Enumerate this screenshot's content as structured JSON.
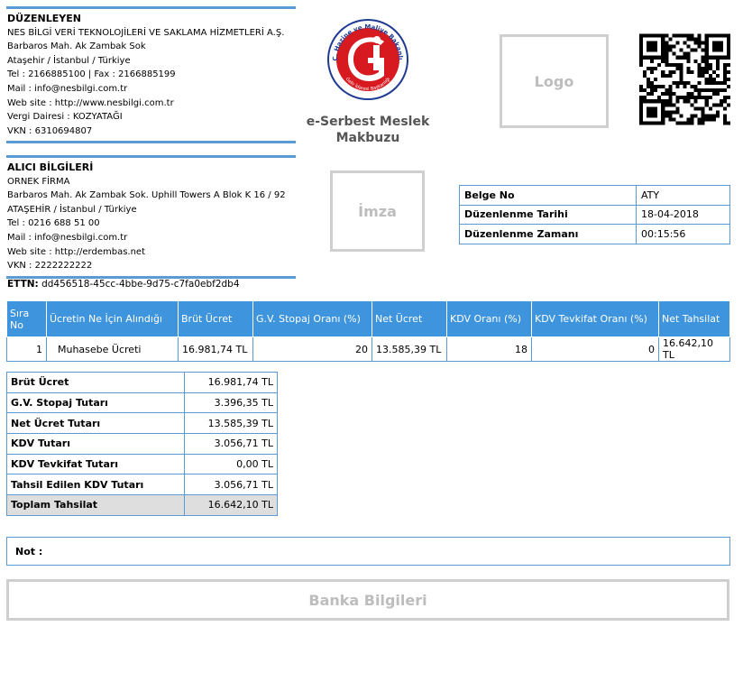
{
  "seller": {
    "title": "DÜZENLEYEN",
    "lines": [
      "NES BİLGİ VERİ TEKNOLOJİLERİ VE SAKLAMA HİZMETLERİ A.Ş.",
      "Barbaros Mah. Ak Zambak Sok",
      "Ataşehir / İstanbul / Türkiye",
      "Tel : 2166885100 | Fax : 2166885199",
      "Mail : info@nesbilgi.com.tr",
      "Web site : http://www.nesbilgi.com.tr",
      "Vergi Dairesi : KOZYATAĞI",
      "VKN : 6310694807"
    ]
  },
  "buyer": {
    "title": "ALICI BİLGİLERİ",
    "lines": [
      "ORNEK FİRMA",
      "Barbaros Mah. Ak Zambak Sok. Uphill Towers A Blok K 16 / 92",
      "ATAŞEHİR / İstanbul / Türkiye",
      "Tel : 0216 688 51 00",
      "Mail : info@nesbilgi.com.tr",
      "Web site : http://erdembas.net",
      "VKN : 2222222222"
    ]
  },
  "emblem": {
    "icon": "gib-emblem-icon",
    "ring_text": "T.C. Hazine ve Maliye Bakanlığı",
    "ring_text_bottom": "Gelir İdaresi Başkanlığı"
  },
  "document_title": [
    "e-Serbest Meslek",
    "Makbuzu"
  ],
  "logo_placeholder": "Logo",
  "signature_placeholder": "İmza",
  "qr": {
    "icon": "qr-code-icon"
  },
  "meta": [
    {
      "label": "Belge No",
      "value": "ATY"
    },
    {
      "label": "Düzenlenme Tarihi",
      "value": "18-04-2018"
    },
    {
      "label": "Düzenlenme Zamanı",
      "value": "00:15:56"
    }
  ],
  "ettn": {
    "label": "ETTN:",
    "value": "dd456518-45cc-4bbe-9d75-c7fa0ebf2db4"
  },
  "items": {
    "headers": [
      "Sıra No",
      "Ücretin Ne İçin Alındığı",
      "Brüt Ücret",
      "G.V. Stopaj Oranı (%)",
      "Net Ücret",
      "KDV Oranı (%)",
      "KDV Tevkifat Oranı (%)",
      "Net Tahsilat"
    ],
    "rows": [
      [
        "1",
        "Muhasebe Ücreti",
        "16.981,74 TL",
        "20",
        "13.585,39 TL",
        "18",
        "0",
        "16.642,10 TL"
      ]
    ]
  },
  "totals": [
    {
      "label": "Brüt Ücret",
      "value": "16.981,74 TL"
    },
    {
      "label": "G.V. Stopaj Tutarı",
      "value": "3.396,35 TL"
    },
    {
      "label": "Net Ücret Tutarı",
      "value": "13.585,39 TL"
    },
    {
      "label": "KDV Tutarı",
      "value": "3.056,71 TL"
    },
    {
      "label": "KDV Tevkifat Tutarı",
      "value": "0,00 TL"
    },
    {
      "label": "Tahsil Edilen KDV Tutarı",
      "value": "3.056,71 TL"
    },
    {
      "label": "Toplam Tahsilat",
      "value": "16.642,10 TL"
    }
  ],
  "note_label": "Not :",
  "bank_info_label": "Banka Bilgileri",
  "colors": {
    "accent": "#5b9bd5",
    "header_bg": "#3e95de",
    "emblem_red": "#d71920",
    "emblem_ring": "#1f3a93"
  }
}
